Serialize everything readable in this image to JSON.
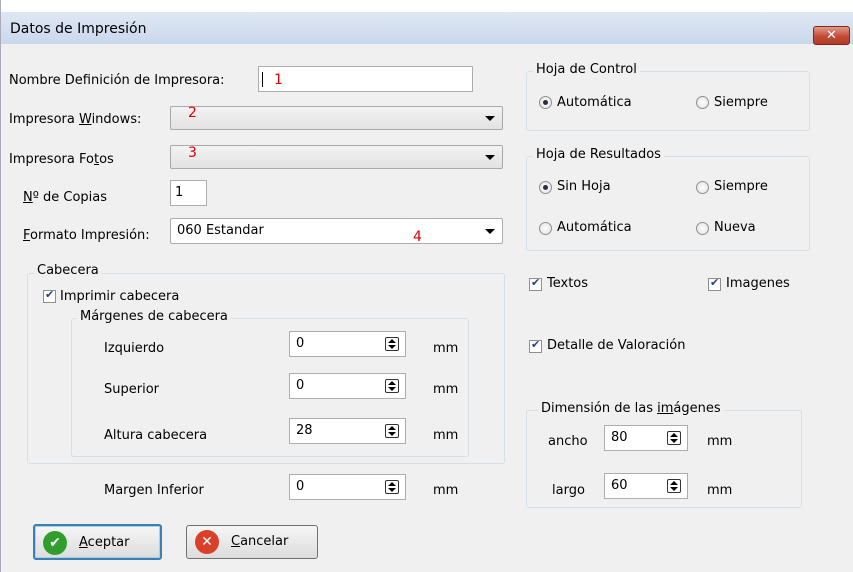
{
  "window": {
    "title": "Datos de Impresión",
    "close_glyph": "✕"
  },
  "fields": {
    "nombre_definicion_label": "Nombre Definición de Impresora:",
    "nombre_definicion_value": "",
    "impresora_windows_label_pre": "Impresora ",
    "impresora_windows_label_u": "W",
    "impresora_windows_label_post": "indows:",
    "impresora_windows_value": "",
    "impresora_fotos_label_pre": "Impresora Fo",
    "impresora_fotos_label_u": "t",
    "impresora_fotos_label_post": "os",
    "impresora_fotos_value": "",
    "copias_label_u": "N",
    "copias_label_post": "º de Copias",
    "copias_value": "1",
    "formato_label_u": "F",
    "formato_label_post": "ormato Impresión:",
    "formato_value": "060 Estandar"
  },
  "annotations": {
    "n1": "1",
    "n2": "2",
    "n3": "3",
    "n4": "4"
  },
  "cabecera": {
    "title": "Cabecera",
    "imprimir_label": "Imprimir cabecera",
    "imprimir_checked": true,
    "margenes_title": "Márgenes de cabecera",
    "izquierdo_label": "Izquierdo",
    "izquierdo_value": "0",
    "superior_label": "Superior",
    "superior_value": "0",
    "altura_label": "Altura cabecera",
    "altura_value": "28",
    "unit": "mm"
  },
  "margen_inferior": {
    "label": "Margen Inferior",
    "value": "0",
    "unit": "mm"
  },
  "hoja_control": {
    "title": "Hoja de Control",
    "options": [
      "Automática",
      "Siempre"
    ],
    "selected": "Automática"
  },
  "hoja_resultados": {
    "title": "Hoja de Resultados",
    "options": [
      "Sin Hoja",
      "Siempre",
      "Automática",
      "Nueva"
    ],
    "selected": "Sin Hoja"
  },
  "checks": {
    "textos": "Textos",
    "textos_checked": true,
    "imagenes": "Imagenes",
    "imagenes_checked": true,
    "detalle": "Detalle de Valoración",
    "detalle_checked": true
  },
  "dimension": {
    "title_pre": "Dimensión de las ",
    "title_u": "im",
    "title_post": "ágenes",
    "ancho_label": "ancho",
    "ancho_value": "80",
    "largo_label": "largo",
    "largo_value": "60",
    "unit": "mm"
  },
  "buttons": {
    "aceptar_u": "A",
    "aceptar_post": "ceptar",
    "aceptar_icon": "✔",
    "cancelar_u": "C",
    "cancelar_post": "ancelar",
    "cancelar_icon": "✕"
  },
  "colors": {
    "ok_icon": "#2f9e2f",
    "cancel_icon": "#d8402a",
    "annotation": "#e00000"
  }
}
